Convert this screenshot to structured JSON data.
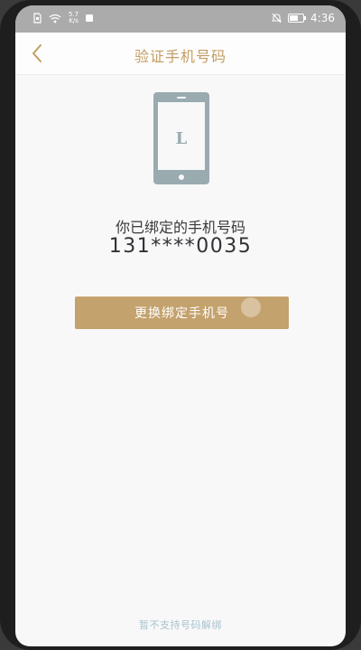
{
  "status_bar": {
    "speed_value": "5.7",
    "speed_unit": "K/s",
    "time": "4:36",
    "icons": [
      "sim-icon",
      "wifi-icon",
      "notification-icon",
      "mute-icon",
      "battery-icon"
    ]
  },
  "header": {
    "title": "验证手机号码",
    "back_icon": "chevron-left-icon"
  },
  "illustration": {
    "icon": "smartphone-icon",
    "letter": "L",
    "color": "#9aabb0"
  },
  "main": {
    "bound_label": "你已绑定的手机号码",
    "phone_number": "131****0035",
    "change_button_label": "更换绑定手机号"
  },
  "footer": {
    "note": "暂不支持号码解绑"
  },
  "colors": {
    "accent": "#c39d63",
    "button": "#c4a26d",
    "footer_text": "#a9c3cf"
  }
}
